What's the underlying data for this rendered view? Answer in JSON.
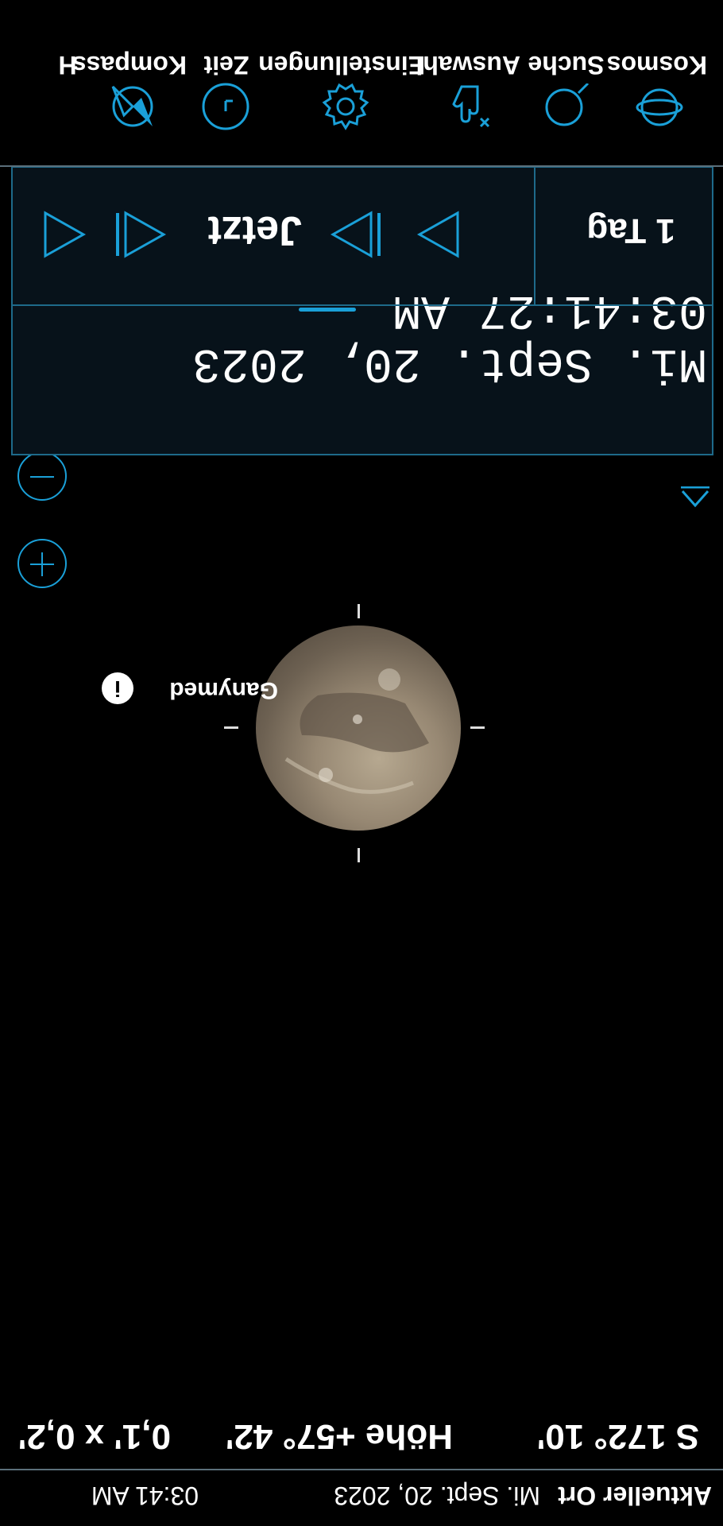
{
  "statusbar": {
    "location": "Aktueller Ort",
    "datetime": "Mi. Sept. 20, 2023",
    "time": "03:41 AM"
  },
  "coords": {
    "azimuth": "S 172° 10'",
    "altitude": "Höhe +57° 42'",
    "fov": "0,1' x 0,2'"
  },
  "object": {
    "name": "Ganymed",
    "info": "i"
  },
  "time_panel": {
    "date": "Mi. Sept. 20, 2023",
    "time": "03:41:27 AM",
    "step": "1 Tag",
    "now": "Jetzt"
  },
  "toolbar": {
    "items": [
      {
        "label": "Kosmos",
        "icon": "orbit-icon"
      },
      {
        "label": "Suche",
        "icon": "search-icon"
      },
      {
        "label": "Auswahl",
        "icon": "select-hand-icon"
      },
      {
        "label": "Einstellungen",
        "icon": "gear-icon"
      },
      {
        "label": "Zeit",
        "icon": "clock-icon"
      },
      {
        "label": "Kompass",
        "icon": "compass-icon"
      },
      {
        "label": "H",
        "icon": ""
      }
    ]
  },
  "colors": {
    "accent": "#1aa0d8",
    "panel": "#07121a",
    "panel_border": "#1e6a8a"
  }
}
